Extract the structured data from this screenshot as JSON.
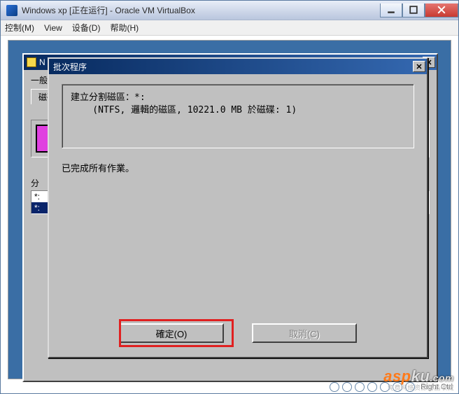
{
  "window": {
    "title": "Windows xp [正在运行] - Oracle VM VirtualBox",
    "menubar": [
      "控制(M)",
      "View",
      "设备(D)",
      "帮助(H)"
    ]
  },
  "under_window": {
    "title_fragment": "N",
    "tab_general_fragment": "一般",
    "tab_disk_fragment": "磁碟",
    "group_partition_fragment": "分",
    "list_row_a": "*:",
    "list_row_b": "*:"
  },
  "dialog": {
    "title": "批次程序",
    "output_line1": "建立分割磁區：*:",
    "output_line2": "    (NTFS, 邏輯的磁區, 10221.0 MB 於磁碟: 1)",
    "status_text": "已完成所有作業。",
    "ok_label": "確定(O)",
    "cancel_label": "取消(C)"
  },
  "vm_statusbar": {
    "host_key_fragment": "Right Ctrl"
  },
  "watermark": {
    "brand_a": "asp",
    "brand_b": "ku",
    "suffix": ".com",
    "subtitle": "免费网络资源精品收藏"
  }
}
